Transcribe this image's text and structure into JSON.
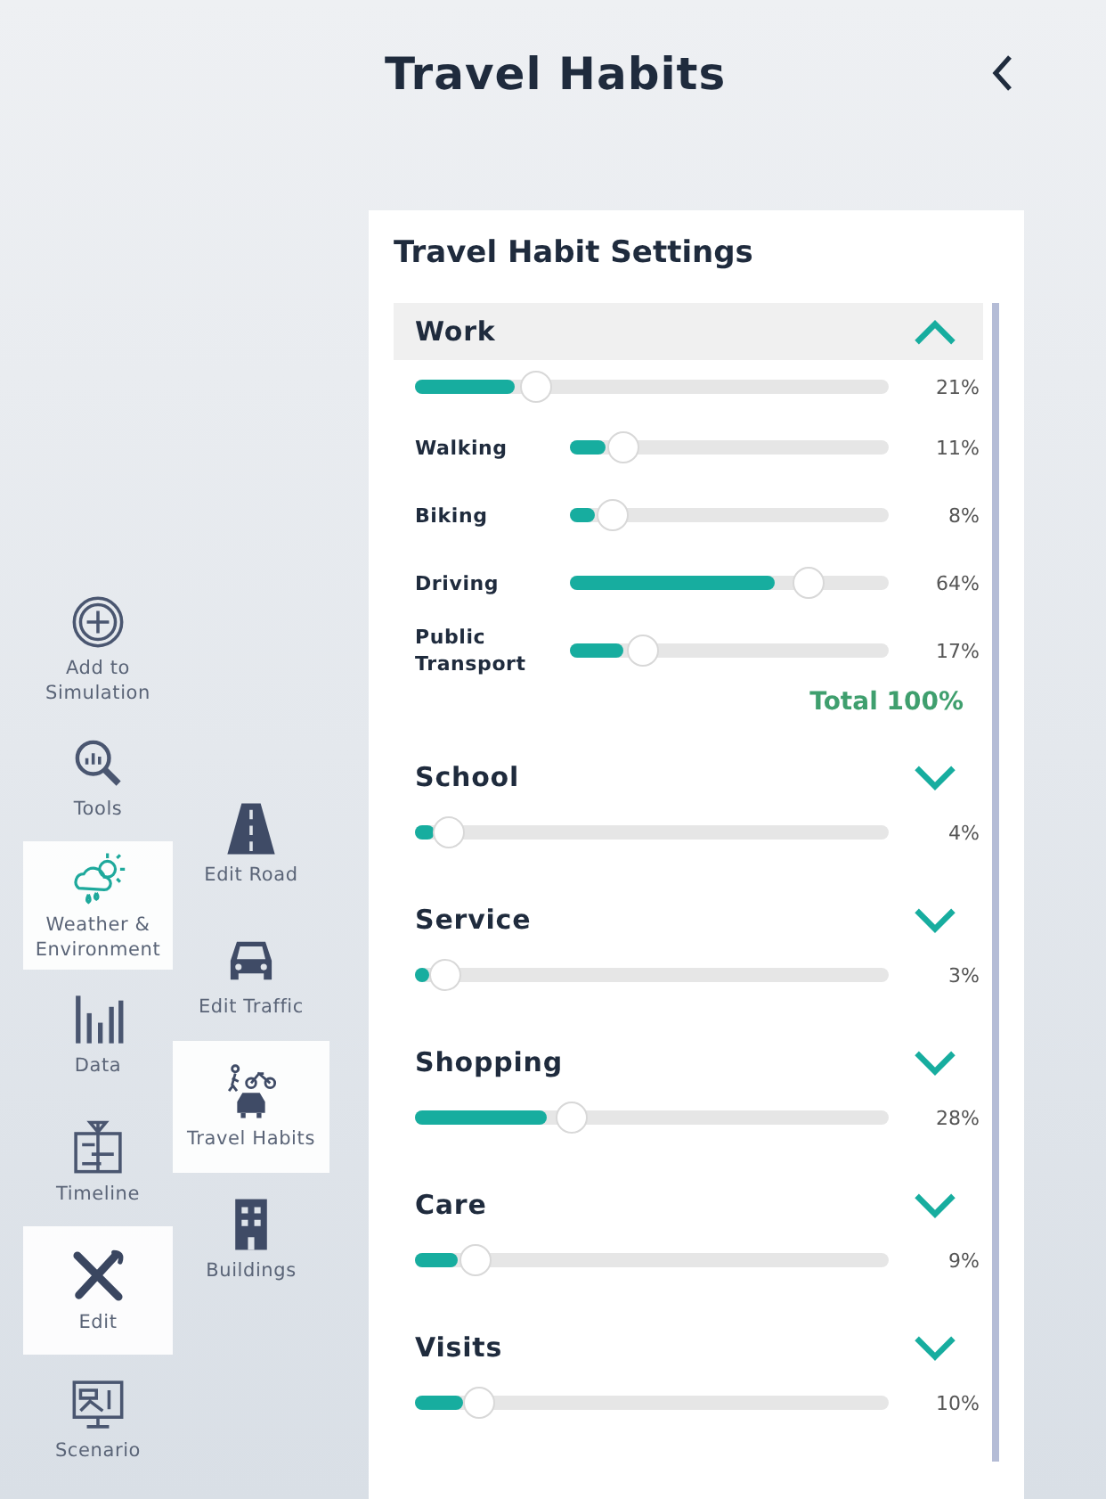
{
  "header": {
    "title": "Travel Habits"
  },
  "tools_primary": [
    {
      "label": "Add to Simulation",
      "kind": "add",
      "selected": false
    },
    {
      "label": "Tools",
      "kind": "tools",
      "selected": false
    },
    {
      "label": "Weather & Environment",
      "kind": "weather",
      "selected": true
    },
    {
      "label": "Data",
      "kind": "data",
      "selected": false
    },
    {
      "label": "Timeline",
      "kind": "timeline",
      "selected": false
    },
    {
      "label": "Edit",
      "kind": "edit",
      "selected": true
    },
    {
      "label": "Scenario",
      "kind": "scenario",
      "selected": false
    }
  ],
  "tools_secondary": [
    {
      "label": "Edit Road",
      "kind": "road",
      "selected": false
    },
    {
      "label": "Edit Traffic",
      "kind": "traffic",
      "selected": false
    },
    {
      "label": "Travel Habits",
      "kind": "travel",
      "selected": true
    },
    {
      "label": "Buildings",
      "kind": "buildings",
      "selected": false
    }
  ],
  "panel": {
    "title": "Travel Habit Settings",
    "categories": [
      {
        "name": "Work",
        "expanded": true,
        "level": 0.21,
        "reading": "21%",
        "modes": [
          {
            "label": "Walking",
            "level": 0.11,
            "reading": "11%"
          },
          {
            "label": "Biking",
            "level": 0.08,
            "reading": "8%"
          },
          {
            "label": "Driving",
            "level": 0.64,
            "reading": "64%"
          },
          {
            "label": "Public Transport",
            "level": 0.17,
            "reading": "17%"
          }
        ],
        "total": "Total 100%"
      },
      {
        "name": "School",
        "expanded": false,
        "level": 0.04,
        "reading": "4%"
      },
      {
        "name": "Service",
        "expanded": false,
        "level": 0.03,
        "reading": "3%"
      },
      {
        "name": "Shopping",
        "expanded": false,
        "level": 0.28,
        "reading": "28%"
      },
      {
        "name": "Care",
        "expanded": false,
        "level": 0.09,
        "reading": "9%"
      },
      {
        "name": "Visits",
        "expanded": false,
        "level": 0.1,
        "reading": "10%"
      }
    ]
  }
}
